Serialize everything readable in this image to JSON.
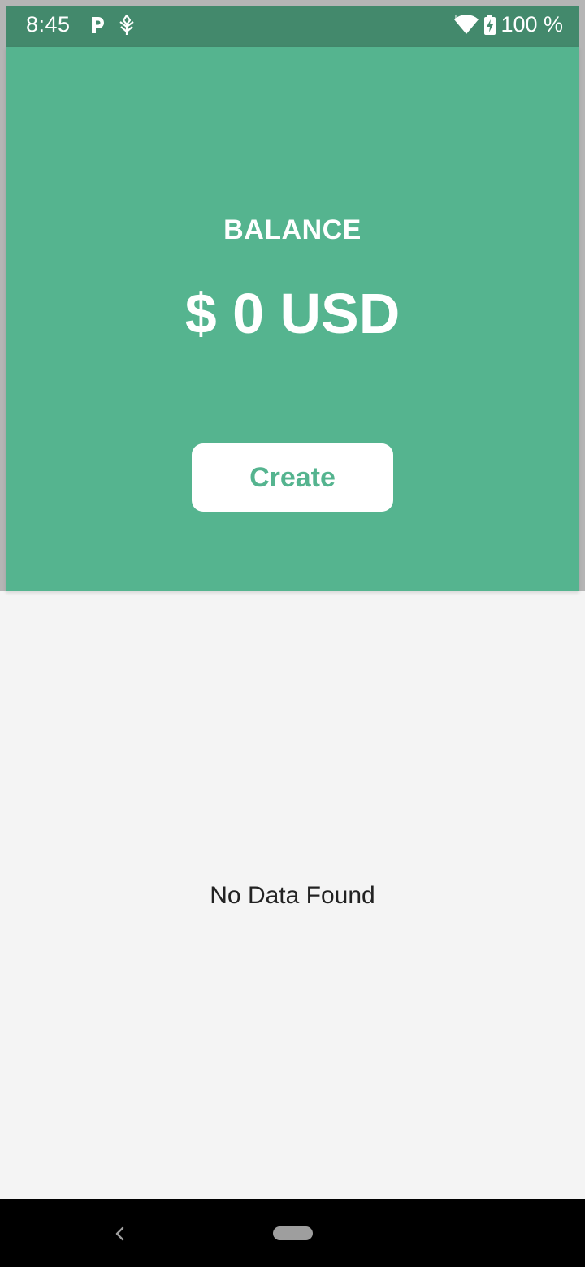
{
  "status_bar": {
    "time": "8:45",
    "battery": "100 %",
    "icons": [
      "p-icon",
      "leaf-icon",
      "wifi-icon",
      "battery-charging-icon"
    ]
  },
  "header": {
    "balance_label": "BALANCE",
    "balance_amount": "$ 0 USD",
    "create_label": "Create"
  },
  "main": {
    "empty_message": "No Data Found"
  },
  "colors": {
    "primary": "#55b48f",
    "status_bar": "#43896c",
    "background": "#f4f4f4",
    "nav_bar": "#000000"
  },
  "nav_bar": {
    "icons": [
      "back-icon",
      "home-pill-icon"
    ]
  }
}
